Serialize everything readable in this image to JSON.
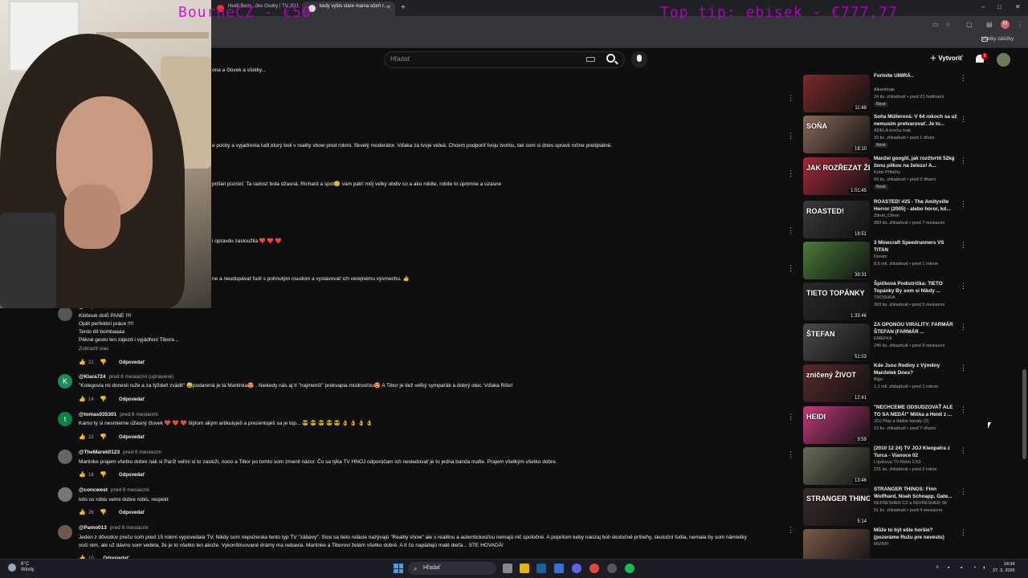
{
  "browser": {
    "tabs": [
      {
        "title": "Heidi Bens...čko Osoby | TV JOJ"
      },
      {
        "title": "kedy vyšlo stare mama očeň r..."
      }
    ],
    "new_tab": "+",
    "window_controls": [
      "–",
      "□",
      "✕"
    ],
    "bookmarks_folder": "Všetky záložky"
  },
  "stream_overlay": {
    "left": "BourneCZ - €50",
    "right": "Top tip: ebisek - €777,77"
  },
  "youtube": {
    "search_placeholder": "Hľadať",
    "create_label": "Vytvoriť",
    "notification_count": "9"
  },
  "cut_lines": [
    "ona  a človek a všetky...",
    "e pocity  a vyjadrenia ludí,ktorý boli v reality show  pred rokmi.  Skvelý moderátor.  Vďaka za tvoje videá. Chcem podporiť tvoju tvorbu, tak som si dnes spravil ročne predplatné.",
    "prišiel pozrieť. Ta radosť bola úžasná. Richard a spol😊 vám patrí môj velky obdiv co a ako robite, robite to úprimne a uzasne",
    "i opravdu zasloužila ❤️ ❤️ ❤️",
    "ne a neudupávať ľudí s pohnutým osudom a vystavovať ich verejnému výsmechu. 👍"
  ],
  "comments": [
    {
      "user": "@...",
      "time": "před 6 mesiacmi",
      "lines": [
        "Klobouk dolů PANE !!!!",
        "Opět perfektní práce !!!!",
        "Tento díl bombaaaa",
        "Pěkné gesto ten zájezd i vyjádření Tibora ..",
        "Zobraziť viac"
      ],
      "likes": "22",
      "reply": "Odpovedať",
      "avatar_letter": "",
      "avatar_color": "#555555"
    },
    {
      "user": "@Klara724",
      "time": "pred 6 mesiacmi (upravené)",
      "lines": [
        "\"Kolegovia mi donesli ruže a za týždeň zvädli\" 😄podarená je tá Martinka😍 . Niekedy nás aj tí \"najmenší\" prekvapia múdrosťou😍  A Tibor je tiež veľký sympaťák a dobrý otec. Vďaka Rišo!"
      ],
      "likes": "14",
      "reply": "Odpovedať",
      "avatar_letter": "K",
      "avatar_color": "#1e8a5a"
    },
    {
      "user": "@tomas035301",
      "time": "pred 6 mesiacmi",
      "lines": [
        "Kamo ty si nesmierne úžasný človek ❤️ ❤️ ❤️  štýlom akým artikuluješ a prezentuješ sa je top... 😎 😎 😎 😎 😎 👌 👌 👌 👌"
      ],
      "likes": "22",
      "reply": "Odpovedať",
      "avatar_letter": "t",
      "avatar_color": "#0b8043"
    },
    {
      "user": "@TheMarek0123",
      "time": "pred 6 mesiacmi",
      "lines": [
        "Martinke prajem všetko dobre nak si Paríž veľmi si to zaslúži, nooo a Tibor po tomto som zmenil názor. Čo sa týka TV  HNOJ odporúčam ich nesledovať je to jedna banda mafie. Prajem všetkým všetko dobre."
      ],
      "likes": "16",
      "reply": "Odpovedať",
      "avatar_letter": "",
      "avatar_color": "#666666"
    },
    {
      "user": "@concwest",
      "time": "pred 6 mesiacmi",
      "lines": [
        "toto co robis velmi dobre robis, respekt"
      ],
      "likes": "26",
      "reply": "Odpovedať",
      "avatar_letter": "",
      "avatar_color": "#777777"
    },
    {
      "user": "@Pamo013",
      "time": "pred 6 mesiacmi",
      "lines": [
        "Jeden z dôvodov prečo som pred 15 rokmi vypovedala TV. Nikdy som nepozerala tento typ TV \"zábavy\". Síce sa tieto relácie nazývajú \"Reality show\" ale s realitou a autentickosťou nemajú nič spoločné. A popritom keby naozaj boli skutočné príbehy, skutoční ľudia, nemala by som námietky",
        "voči nim, ale už dávno som vedela, že je to všetko len akože. Vykonštruované drámy ma nebavia. Martinke a Tiborovi želám všetko dobré. A tí čo napádajú malé dieťa... STE HOVADÁ!"
      ],
      "likes": "10",
      "reply": "Odpovedať",
      "avatar_letter": "",
      "avatar_color": "#6d5a4a"
    }
  ],
  "sidebar": [
    {
      "title": "Fortnite UMIRÁ..",
      "channel": "Alkanhraje",
      "meta": "24 tis. zhliadnutí • pred 21 hodinami",
      "badge": "Nové",
      "duration": "11:48",
      "caption": "",
      "color": "#7a2a2a"
    },
    {
      "title": "Soňa Müllerová: V 64 rokoch sa už nemusím pretvarovať. Je to...",
      "channel": "ADELA trochu inak",
      "meta": "33 tis. zhliadnutí • pred 1 dňom",
      "badge": "Nové",
      "duration": "18:10",
      "caption": "SOŇA",
      "color": "#8a6a5a"
    },
    {
      "title": "Manžel googlil, jak rozčtvrtit 52kg ženu pilkou na železo! A...",
      "channel": "Krimi Příběhy",
      "meta": "69 tis. zhliadnutí • pred 3 dňami",
      "badge": "Nové",
      "duration": "1:01:45",
      "caption": "JAK ROZŘEZAT ŽENU",
      "color": "#a02a3a"
    },
    {
      "title": "ROASTED! #25 - The Amityville Horror (2005) - alebo horor, kd...",
      "channel": "Zitron_Citron",
      "meta": "983 tis. zhliadnutí • pred 7 mesiacmi",
      "badge": "",
      "duration": "18:51",
      "caption": "ROASTED!",
      "color": "#3a3a3a"
    },
    {
      "title": "3 Minecraft Speedrunners VS TITAN",
      "channel": "Dream",
      "meta": "8,6 mil. zhliadnutí • pred 1 rokom",
      "badge": "",
      "duration": "39:31",
      "caption": "",
      "color": "#4a7a3a"
    },
    {
      "title": "Špičková Podistrička: TIETO Topánky By som si Nikdy ...",
      "channel": "TROSHKA",
      "meta": "260 tis. zhliadnutí • pred 5 mesiacmi",
      "badge": "",
      "duration": "1:33:46",
      "caption": "TIETO TOPÁNKY",
      "color": "#2a2a2a"
    },
    {
      "title": "ZA OPONOU VIRALITY: FARMÁR ŠTEFAN (FARMÁR ...",
      "channel": "EMEFKA",
      "meta": "246 tis. zhliadnutí • pred 9 mesiacmi",
      "badge": "",
      "duration": "51:03",
      "caption": "ŠTEFAN",
      "color": "#4a4a4a"
    },
    {
      "title": "Kde Jsou Rodiny z Výměny Manželek Dnes?",
      "channel": "Bigo",
      "meta": "1,1 mil. zhliadnutí • pred 1 rokom",
      "badge": "",
      "duration": "12:41",
      "caption": "zničený ŽIVOT",
      "color": "#5a2a2a"
    },
    {
      "title": "\"NECHCEME ODSUDZOVAŤ ALE TO SA NEDÁ!\" Miška a Heidi z ...",
      "channel": "JOJ Play a ďalšie kanály (2)",
      "meta": "13 tis. zhliadnutí • pred 7 dňami",
      "badge": "",
      "duration": "9:59",
      "caption": "HEIDI",
      "color": "#c03a7a"
    },
    {
      "title": "(2010 12 24) TV JOJ Kleopatra z Turca - Vianoce 02",
      "channel": "Lojzikova TV Retro CS3",
      "meta": "131 tis. zhliadnutí • pred 2 rokmi",
      "badge": "",
      "duration": "13:46",
      "caption": "",
      "color": "#6a6a5a"
    },
    {
      "title": "STRANGER THINGS: Finn Wolfhard, Noah Schnapp, Gate...",
      "channel": "REFRESHER CZ a REFRESHER SK",
      "meta": "51 tis. zhliadnutí • pred 4 mesiacmi",
      "badge": "",
      "duration": "5:14",
      "caption": "STRANGER THINGS",
      "color": "#3a2a2a"
    },
    {
      "title": "Může to být ešte horšie? (pozeráme Ružu pre nevestu)",
      "channel": "MIZNIII",
      "meta": "",
      "badge": "",
      "duration": "",
      "caption": "",
      "color": "#7a5a4a"
    }
  ],
  "taskbar": {
    "weather_temp": "6°C",
    "weather_desc": "Windy",
    "search_label": "Hľadať",
    "time": "14:34",
    "date": "27. 3. 2026"
  }
}
